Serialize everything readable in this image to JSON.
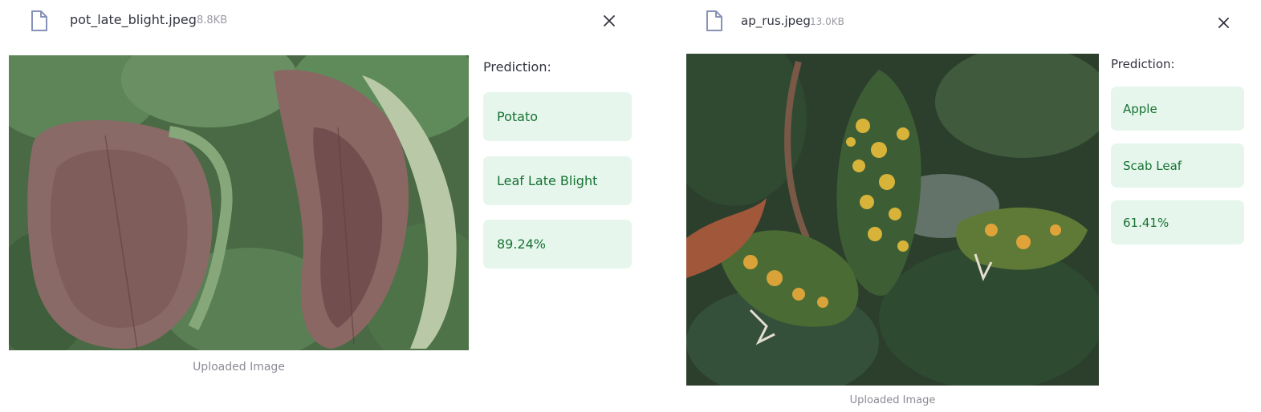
{
  "colors": {
    "success_bg": "#e6f6ec",
    "success_text": "#177233",
    "icon": "#8792b8"
  },
  "uploads": [
    {
      "file_name": "pot_late_blight.jpeg",
      "file_size": "8.8KB",
      "file_icon": "file-icon",
      "close_icon": "close-icon",
      "caption": "Uploaded Image",
      "prediction_label": "Prediction:",
      "predictions": [
        "Potato",
        "Leaf Late Blight",
        "89.24%"
      ]
    },
    {
      "file_name": "ap_rus.jpeg",
      "file_size": "13.0KB",
      "file_icon": "file-icon",
      "close_icon": "close-icon",
      "caption": "Uploaded Image",
      "prediction_label": "Prediction:",
      "predictions": [
        "Apple",
        "Scab Leaf",
        "61.41%"
      ]
    }
  ]
}
